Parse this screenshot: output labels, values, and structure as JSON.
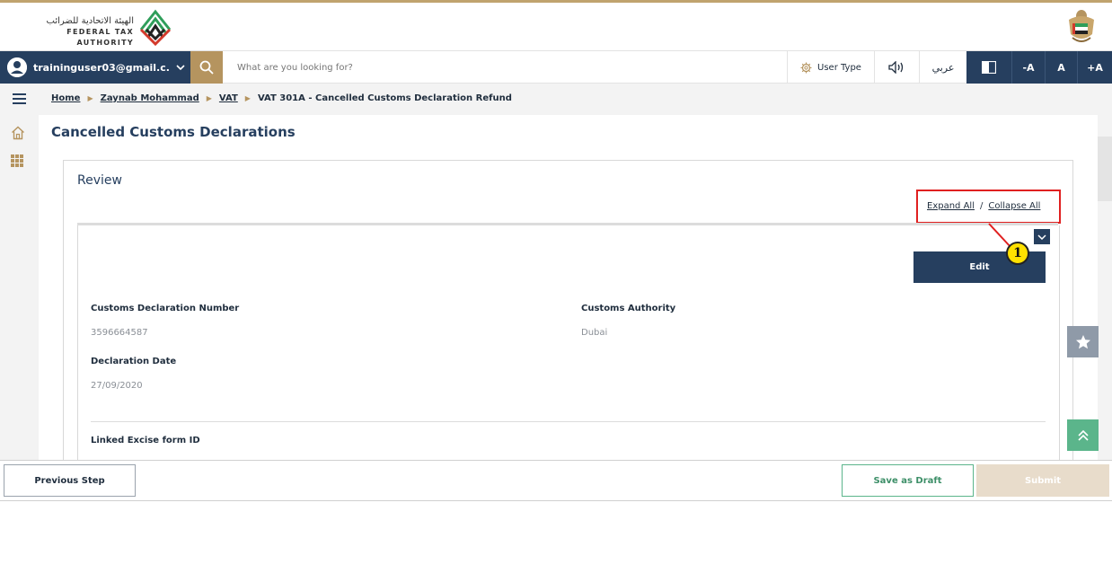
{
  "header": {
    "logo_text_ar": "الهيئة الاتحادية للضرائب",
    "logo_text_en": "FEDERAL TAX AUTHORITY",
    "logo_icon": "fta-logo-icon",
    "emblem_icon": "uae-emblem-icon"
  },
  "toolbar": {
    "user_email": "traininguser03@gmail.c...",
    "search_placeholder": "What are you looking for?",
    "user_type_label": "User Type",
    "language_label": "عربي",
    "font_decrease_label": "-A",
    "font_reset_label": "A",
    "font_increase_label": "+A"
  },
  "breadcrumb": {
    "items": [
      "Home",
      "Zaynab Mohammad",
      "VAT"
    ],
    "current": "VAT 301A - Cancelled Customs Declaration Refund"
  },
  "page": {
    "title": "Cancelled Customs Declarations"
  },
  "review": {
    "title": "Review",
    "expand_all": "Expand All",
    "separator": "/",
    "collapse_all": "Collapse All",
    "callout_number": "1",
    "edit_label": "Edit",
    "fields": {
      "customs_declaration_number_label": "Customs Declaration Number",
      "customs_declaration_number_value": "3596664587",
      "customs_authority_label": "Customs Authority",
      "customs_authority_value": "Dubai",
      "declaration_date_label": "Declaration Date",
      "declaration_date_value": "27/09/2020",
      "linked_excise_form_label": "Linked Excise form ID"
    }
  },
  "footer": {
    "previous_label": "Previous Step",
    "save_draft_label": "Save as Draft",
    "submit_label": "Submit"
  },
  "colors": {
    "primary": "#263f5f",
    "gold": "#b5945f",
    "green": "#5bb58b",
    "callout_red": "#e02020"
  }
}
